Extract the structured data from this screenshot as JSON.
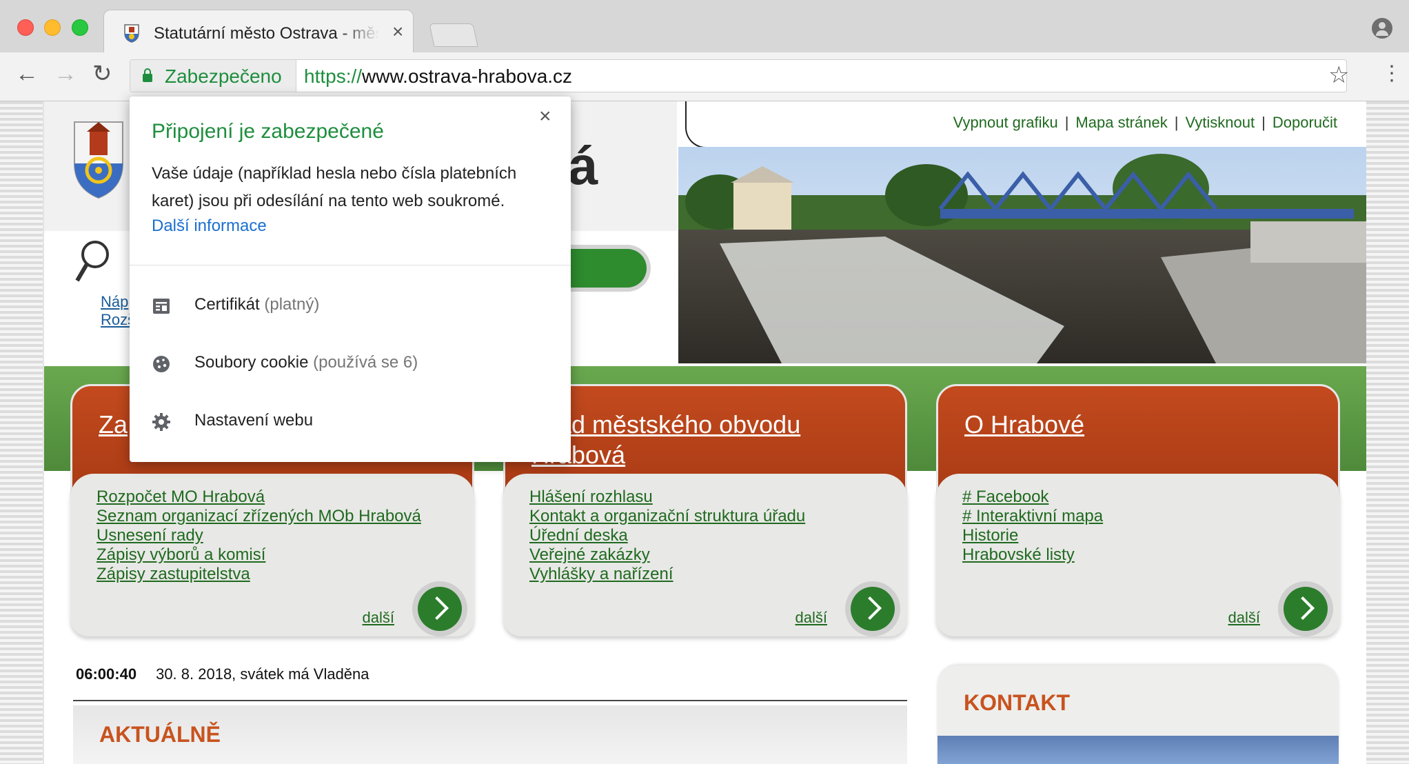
{
  "tab": {
    "title": "Statutární město Ostrava - městský obvod Hrabová"
  },
  "toolbar": {
    "secure_label": "Zabezpečeno",
    "url_scheme": "https://",
    "url_host": "www.ostrava-hrabova.cz"
  },
  "popup": {
    "title": "Připojení je zabezpečené",
    "description": "Vaše údaje (například hesla nebo čísla platebních karet) jsou při odesílání na tento web soukromé.",
    "link": "Další informace",
    "rows": [
      {
        "label": "Certifikát",
        "sub": "(platný)"
      },
      {
        "label": "Soubory cookie",
        "sub": "(používá se 6)"
      },
      {
        "label": "Nastavení webu",
        "sub": ""
      }
    ]
  },
  "site": {
    "topnav": [
      "Vypnout grafiku",
      "Mapa stránek",
      "Vytisknout",
      "Doporučit"
    ],
    "logo_letter": "á",
    "search_links": [
      "Náp",
      "Rozš"
    ],
    "cards": [
      {
        "title": "Za",
        "links": [
          "Rozpočet MO Hrabová",
          "Seznam organizací zřízených MOb Hrabová",
          "Usnesení rady",
          "Zápisy výborů a komisí",
          "Zápisy zastupitelstva"
        ],
        "more": "další"
      },
      {
        "title": "Úřad městského obvodu Hrabová",
        "links": [
          "Hlášení rozhlasu",
          "Kontakt a organizační struktura úřadu",
          "Úřední deska",
          "Veřejné zakázky",
          "Vyhlášky a nařízení"
        ],
        "more": "další"
      },
      {
        "title": "O Hrabové",
        "links": [
          "# Facebook",
          "# Interaktivní mapa",
          "Historie",
          "Hrabovské listy"
        ],
        "more": "další"
      }
    ],
    "clock": "06:00:40",
    "date_text": "30. 8. 2018, svátek má Vladěna",
    "news_heading": "AKTUÁLNĚ",
    "contact_heading": "KONTAKT"
  },
  "colors": {
    "secure_green": "#1e8e3e",
    "link_blue": "#1a6fd0",
    "card_red": "#b5411a",
    "site_green": "#1f6a1f",
    "heading_orange": "#c8531e"
  }
}
